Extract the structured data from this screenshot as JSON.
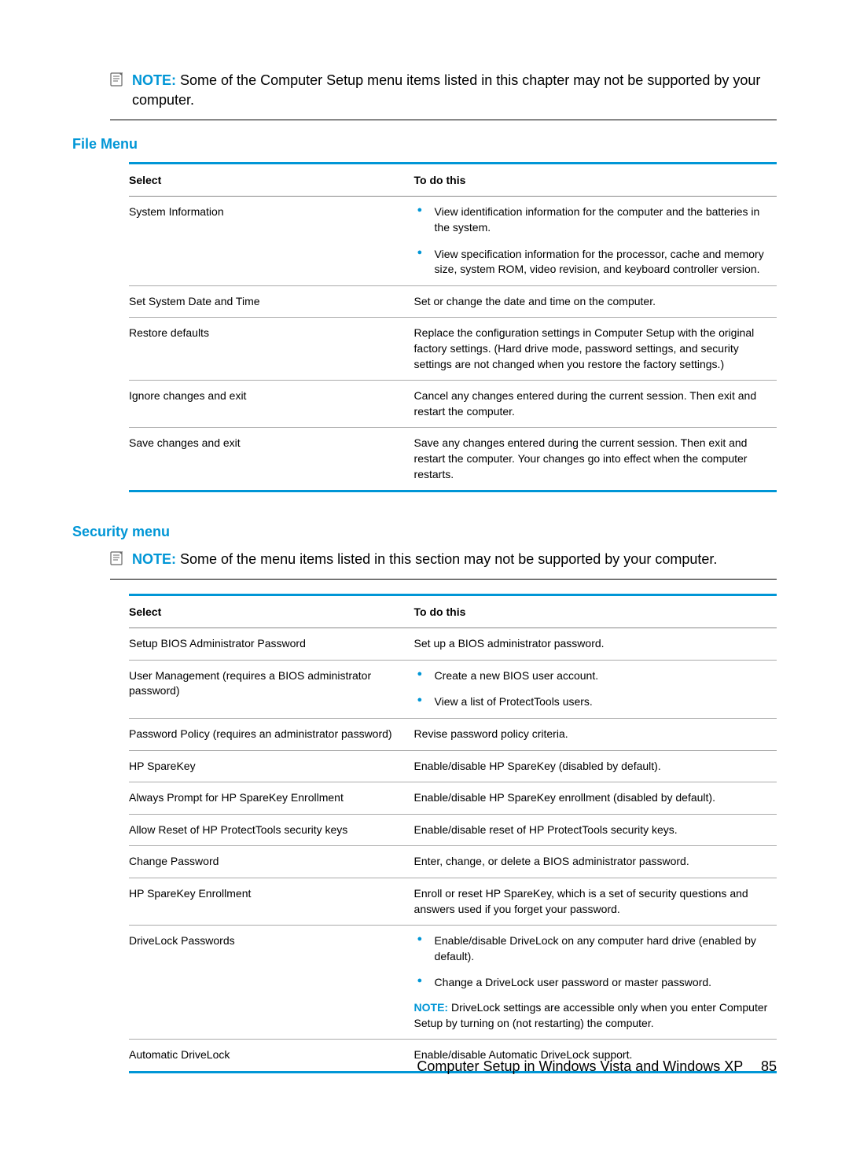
{
  "note1": {
    "label": "NOTE:",
    "text": "Some of the Computer Setup menu items listed in this chapter may not be supported by your computer."
  },
  "fileMenu": {
    "heading": "File Menu",
    "headers": {
      "select": "Select",
      "todo": "To do this"
    },
    "rows": [
      {
        "select": "System Information",
        "bullets": [
          "View identification information for the computer and the batteries in the system.",
          "View specification information for the processor, cache and memory size, system ROM, video revision, and keyboard controller version."
        ]
      },
      {
        "select": "Set System Date and Time",
        "text": "Set or change the date and time on the computer."
      },
      {
        "select": "Restore defaults",
        "text": "Replace the configuration settings in Computer Setup with the original factory settings. (Hard drive mode, password settings, and security settings are not changed when you restore the factory settings.)"
      },
      {
        "select": "Ignore changes and exit",
        "text": "Cancel any changes entered during the current session. Then exit and restart the computer."
      },
      {
        "select": "Save changes and exit",
        "text": "Save any changes entered during the current session. Then exit and restart the computer. Your changes go into effect when the computer restarts."
      }
    ]
  },
  "securityMenu": {
    "heading": "Security menu",
    "note": {
      "label": "NOTE:",
      "text": "Some of the menu items listed in this section may not be supported by your computer."
    },
    "headers": {
      "select": "Select",
      "todo": "To do this"
    },
    "rows": [
      {
        "select": "Setup BIOS Administrator Password",
        "text": "Set up a BIOS administrator password."
      },
      {
        "select": "User Management (requires a BIOS administrator password)",
        "bullets": [
          "Create a new BIOS user account.",
          "View a list of ProtectTools users."
        ]
      },
      {
        "select": "Password Policy (requires an administrator password)",
        "text": "Revise password policy criteria."
      },
      {
        "select": "HP SpareKey",
        "text": "Enable/disable HP SpareKey (disabled by default)."
      },
      {
        "select": "Always Prompt for HP SpareKey Enrollment",
        "text": "Enable/disable HP SpareKey enrollment (disabled by default)."
      },
      {
        "select": "Allow Reset of HP ProtectTools security keys",
        "text": "Enable/disable reset of HP ProtectTools security keys."
      },
      {
        "select": "Change Password",
        "text": "Enter, change, or delete a BIOS administrator password."
      },
      {
        "select": "HP SpareKey Enrollment",
        "text": "Enroll or reset HP SpareKey, which is a set of security questions and answers used if you forget your password."
      },
      {
        "select": "DriveLock Passwords",
        "bullets": [
          "Enable/disable DriveLock on any computer hard drive (enabled by default).",
          "Change a DriveLock user password or master password."
        ],
        "inlineNote": {
          "label": "NOTE:",
          "text": "DriveLock settings are accessible only when you enter Computer Setup by turning on (not restarting) the computer."
        }
      },
      {
        "select": "Automatic DriveLock",
        "text": "Enable/disable Automatic DriveLock support."
      }
    ]
  },
  "footer": {
    "title": "Computer Setup in Windows Vista and Windows XP",
    "page": "85"
  }
}
